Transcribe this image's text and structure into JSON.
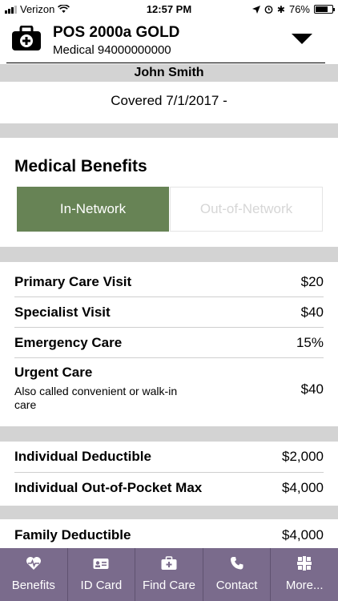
{
  "status": {
    "carrier": "Verizon",
    "time": "12:57 PM",
    "battery": "76%",
    "battery_level": 0.76
  },
  "plan": {
    "name": "POS 2000a GOLD",
    "type": "Medical",
    "id": "94000000000"
  },
  "member": {
    "name": "John Smith"
  },
  "coverage": {
    "text": "Covered 7/1/2017 -"
  },
  "benefits": {
    "title": "Medical Benefits",
    "in_network_label": "In-Network",
    "out_network_label": "Out-of-Network",
    "selected": "In-Network"
  },
  "visits": [
    {
      "label": "Primary Care Visit",
      "value": "$20"
    },
    {
      "label": "Specialist Visit",
      "value": "$40"
    },
    {
      "label": "Emergency Care",
      "value": "15%"
    },
    {
      "label": "Urgent Care",
      "value": "$40",
      "note": "Also called convenient or walk-in care"
    }
  ],
  "individual": [
    {
      "label": "Individual Deductible",
      "value": "$2,000"
    },
    {
      "label": "Individual Out-of-Pocket Max",
      "value": "$4,000"
    }
  ],
  "family": [
    {
      "label": "Family Deductible",
      "value": "$4,000"
    }
  ],
  "tabs": [
    {
      "label": "Benefits",
      "icon": "heart-pulse-icon"
    },
    {
      "label": "ID Card",
      "icon": "id-card-icon"
    },
    {
      "label": "Find Care",
      "icon": "medical-bag-icon"
    },
    {
      "label": "Contact",
      "icon": "phone-icon"
    },
    {
      "label": "More...",
      "icon": "more-grid-icon"
    }
  ],
  "colors": {
    "accent_green": "#678355",
    "tab_bar": "#7a6b8c",
    "section_gap": "#d3d3d3"
  }
}
